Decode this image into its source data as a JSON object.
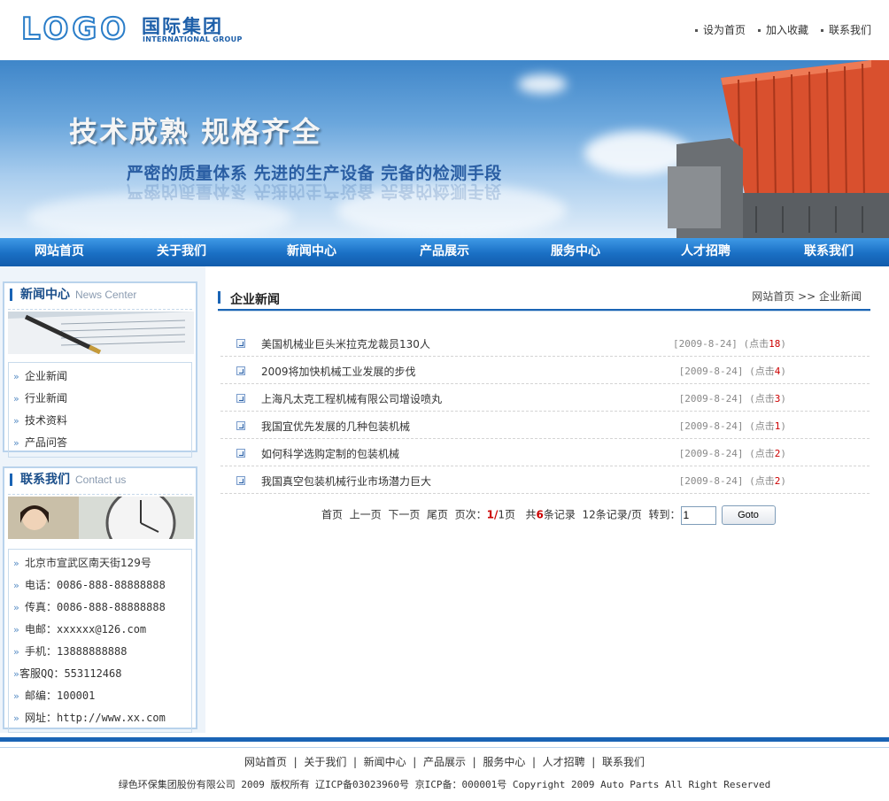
{
  "header": {
    "logo_word": "LOGO",
    "logo_cn": "国际集团",
    "logo_en": "INTERNATIONAL GROUP",
    "top_links": [
      "设为首页",
      "加入收藏",
      "联系我们"
    ]
  },
  "banner": {
    "headline": "技术成熟  规格齐全",
    "subline": "严密的质量体系 先进的生产设备 完备的检测手段"
  },
  "nav": [
    "网站首页",
    "关于我们",
    "新闻中心",
    "产品展示",
    "服务中心",
    "人才招聘",
    "联系我们"
  ],
  "sidebar": {
    "news_box": {
      "title": "新闻中心",
      "title_en": "News Center",
      "items": [
        "企业新闻",
        "行业新闻",
        "技术资料",
        "产品问答"
      ]
    },
    "contact_box": {
      "title": "联系我们",
      "title_en": "Contact us",
      "items": [
        "北京市宣武区南天街129号",
        "电话：0086-888-88888888",
        "传真：0086-888-88888888",
        "电邮：xxxxxx@126.com",
        "手机：13888888888",
        "客服QQ：553112468",
        "邮编：100001",
        "网址：http://www.xx.com"
      ]
    }
  },
  "main": {
    "title": "企业新闻",
    "breadcrumb": "网站首页 >> 企业新闻",
    "news": [
      {
        "title": "美国机械业巨头米拉克龙裁员130人",
        "date": "[2009-8-24]",
        "clicks_prefix": "(点击",
        "clicks": "18",
        "clicks_suffix": ")"
      },
      {
        "title": "2009将加快机械工业发展的步伐",
        "date": "[2009-8-24]",
        "clicks_prefix": "(点击",
        "clicks": "4",
        "clicks_suffix": ")"
      },
      {
        "title": "上海凡太克工程机械有限公司增设喷丸",
        "date": "[2009-8-24]",
        "clicks_prefix": "(点击",
        "clicks": "3",
        "clicks_suffix": ")"
      },
      {
        "title": "我国宜优先发展的几种包装机械",
        "date": "[2009-8-24]",
        "clicks_prefix": "(点击",
        "clicks": "1",
        "clicks_suffix": ")"
      },
      {
        "title": "如何科学选购定制的包装机械",
        "date": "[2009-8-24]",
        "clicks_prefix": "(点击",
        "clicks": "2",
        "clicks_suffix": ")"
      },
      {
        "title": "我国真空包装机械行业市场潜力巨大",
        "date": "[2009-8-24]",
        "clicks_prefix": "(点击",
        "clicks": "2",
        "clicks_suffix": ")"
      }
    ],
    "pager": {
      "first": "首页",
      "prev": "上一页",
      "next": "下一页",
      "last": "尾页",
      "page_label": "页次：",
      "page_current": "1",
      "page_sep": "/",
      "page_total": "1",
      "page_unit": "页",
      "total_prefix": "共",
      "total_count": "6",
      "total_suffix": "条记录",
      "per_page": "12条记录/页",
      "goto_label": "转到：",
      "goto_value": "1",
      "goto_button": "Goto"
    }
  },
  "footer": {
    "links": [
      "网站首页",
      "关于我们",
      "新闻中心",
      "产品展示",
      "服务中心",
      "人才招聘",
      "联系我们"
    ],
    "copyright": "绿色环保集团股份有限公司 2009 版权所有 辽ICP备03023960号 京ICP备：000001号 Copyright 2009 Auto Parts All Right Reserved"
  }
}
